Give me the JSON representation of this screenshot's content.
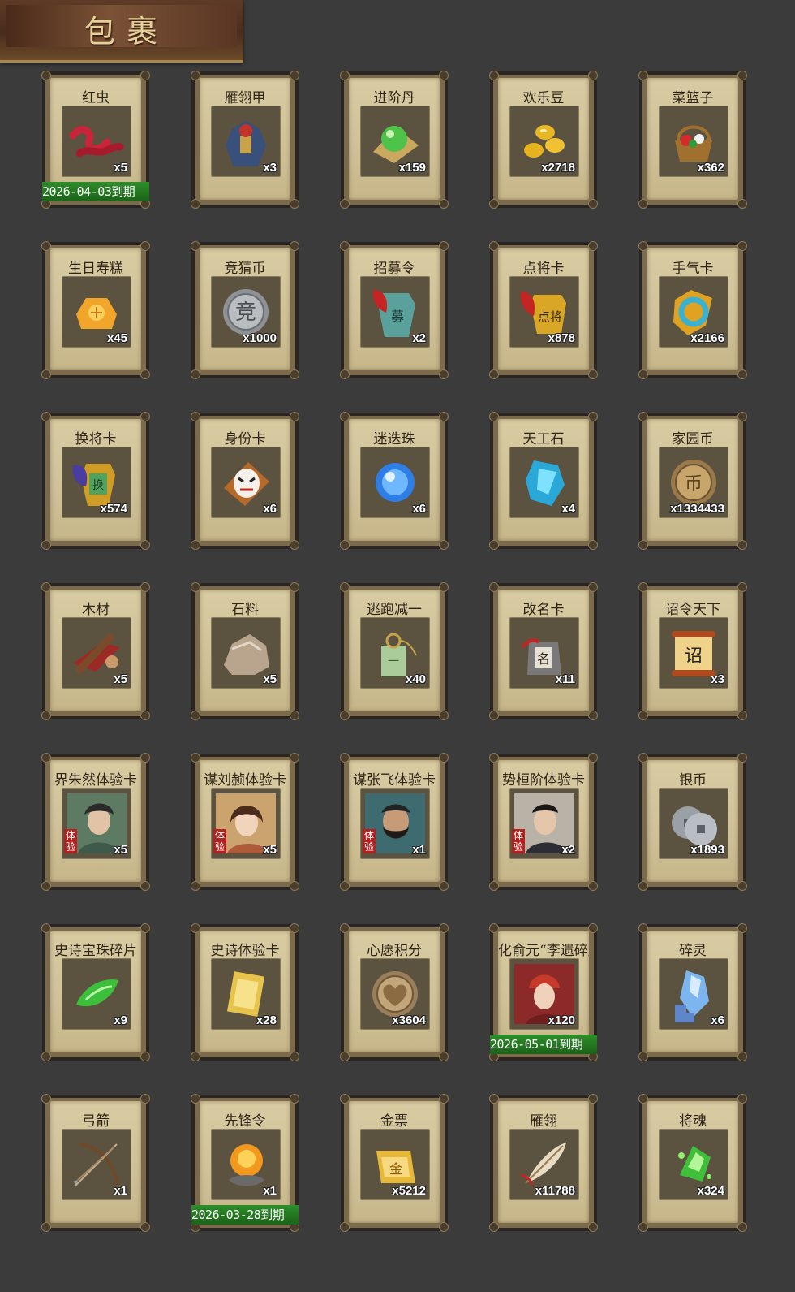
{
  "header": {
    "title": "包裹"
  },
  "items": [
    {
      "name": "红虫",
      "qty": "x5",
      "icon": "red-worm-icon",
      "expiry": "2026-04-03到期"
    },
    {
      "name": "雁翎甲",
      "qty": "x3",
      "icon": "armor-icon"
    },
    {
      "name": "进阶丹",
      "qty": "x159",
      "icon": "green-pill-icon"
    },
    {
      "name": "欢乐豆",
      "qty": "x2718",
      "icon": "gold-beans-icon"
    },
    {
      "name": "菜篮子",
      "qty": "x362",
      "icon": "basket-icon"
    },
    {
      "name": "生日寿糕",
      "qty": "x45",
      "icon": "birthday-cake-icon"
    },
    {
      "name": "竞猜币",
      "qty": "x1000",
      "icon": "silver-coin-icon"
    },
    {
      "name": "招募令",
      "qty": "x2",
      "icon": "recruit-token-icon"
    },
    {
      "name": "点将卡",
      "qty": "x878",
      "icon": "general-card-icon"
    },
    {
      "name": "手气卡",
      "qty": "x2166",
      "icon": "luck-card-icon"
    },
    {
      "name": "换将卡",
      "qty": "x574",
      "icon": "swap-card-icon"
    },
    {
      "name": "身份卡",
      "qty": "x6",
      "icon": "mask-card-icon"
    },
    {
      "name": "迷迭珠",
      "qty": "x6",
      "icon": "blue-orb-icon"
    },
    {
      "name": "天工石",
      "qty": "x4",
      "icon": "blue-gem-icon"
    },
    {
      "name": "家园币",
      "qty": "x1334433",
      "icon": "home-coin-icon"
    },
    {
      "name": "木材",
      "qty": "x5",
      "icon": "wood-icon"
    },
    {
      "name": "石料",
      "qty": "x5",
      "icon": "stone-icon"
    },
    {
      "name": "逃跑减一",
      "qty": "x40",
      "icon": "jade-tag-icon"
    },
    {
      "name": "改名卡",
      "qty": "x11",
      "icon": "rename-card-icon"
    },
    {
      "name": "诏令天下",
      "qty": "x3",
      "icon": "scroll-icon"
    },
    {
      "name": "界朱然体验卡",
      "qty": "x5",
      "icon": "portrait-zhuran-icon",
      "badge": "体验"
    },
    {
      "name": "谋刘赪体验卡",
      "qty": "x5",
      "icon": "portrait-liucheng-icon",
      "badge": "体验"
    },
    {
      "name": "谋张飞体验卡",
      "qty": "x1",
      "icon": "portrait-zhangfei-icon",
      "badge": "体验"
    },
    {
      "name": "势桓阶体验卡",
      "qty": "x2",
      "icon": "portrait-huanjie-icon",
      "badge": "体验"
    },
    {
      "name": "银币",
      "qty": "x1893",
      "icon": "silver-coins-icon"
    },
    {
      "name": "史诗宝珠碎片",
      "qty": "x9",
      "icon": "green-shard-icon"
    },
    {
      "name": "史诗体验卡",
      "qty": "x28",
      "icon": "gold-card-icon"
    },
    {
      "name": "心愿积分",
      "qty": "x3604",
      "icon": "heart-coin-icon"
    },
    {
      "name": "化俞元“李遗碎片",
      "qty": "x120",
      "icon": "portrait-red-helmet-icon",
      "expiry": "2026-05-01到期"
    },
    {
      "name": "碎灵",
      "qty": "x6",
      "icon": "crystal-puzzle-icon"
    },
    {
      "name": "弓箭",
      "qty": "x1",
      "icon": "bow-arrow-icon"
    },
    {
      "name": "先锋令",
      "qty": "x1",
      "icon": "fire-stone-icon",
      "expiry": "2026-03-28到期"
    },
    {
      "name": "金票",
      "qty": "x5212",
      "icon": "gold-ticket-icon"
    },
    {
      "name": "雁翎",
      "qty": "x11788",
      "icon": "feather-icon"
    },
    {
      "name": "将魂",
      "qty": "x324",
      "icon": "green-soul-icon"
    }
  ]
}
